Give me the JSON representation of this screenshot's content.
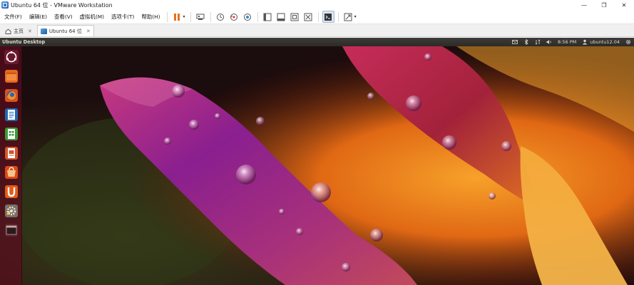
{
  "window": {
    "title": "Ubuntu 64 位 - VMware Workstation",
    "min_glyph": "—",
    "max_glyph": "❐",
    "close_glyph": "✕"
  },
  "menu": {
    "items": [
      "文件(F)",
      "编辑(E)",
      "查看(V)",
      "虚拟机(M)",
      "选项卡(T)",
      "帮助(H)"
    ]
  },
  "toolbar": {
    "buttons": [
      "pause-icon",
      "send-ctrl-alt-del-icon",
      "snapshot-icon",
      "revert-snapshot-icon",
      "snapshot-manager-icon",
      "library-icon",
      "thumbnail-icon",
      "fullscreen-icon",
      "unity-icon",
      "console-view-icon",
      "stretch-icon"
    ],
    "dropdown_glyph": "▾"
  },
  "tabs": {
    "home_label": "主页",
    "vm_label": "Ubuntu 64 位",
    "close_glyph": "✕"
  },
  "ubuntu_panel": {
    "title": "Ubuntu Desktop",
    "time": "8:56 PM",
    "user": "ubuntu12.04"
  },
  "launcher": {
    "items": [
      "dash-home-icon",
      "files-icon",
      "firefox-icon",
      "libreoffice-writer-icon",
      "libreoffice-calc-icon",
      "libreoffice-impress-icon",
      "ubuntu-software-center-icon",
      "ubuntu-one-icon",
      "system-settings-icon",
      "workspace-switcher-icon"
    ]
  },
  "colors": {
    "panel_bg": "#3c3b37",
    "launcher_bg": "#5a0c1e",
    "accent_orange": "#e95420"
  }
}
